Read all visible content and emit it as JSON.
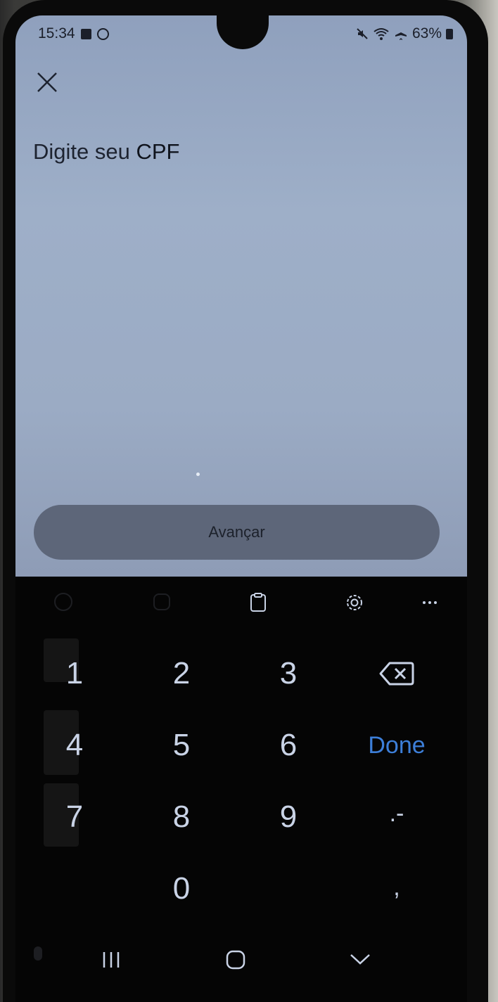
{
  "status_bar": {
    "time": "15:34",
    "battery": "63%"
  },
  "header": {
    "title_prefix": "Digite seu ",
    "title_bold": "CPF"
  },
  "actions": {
    "next_label": "Avançar"
  },
  "keyboard": {
    "keys": {
      "k1": "1",
      "k2": "2",
      "k3": "3",
      "k4": "4",
      "k5": "5",
      "k6": "6",
      "k7": "7",
      "k8": "8",
      "k9": "9",
      "k0": "0",
      "dotdash": ".-",
      "comma": ",",
      "done": "Done"
    }
  },
  "colors": {
    "screen_bg": "#9eafc8",
    "button_bg": "#5d6679",
    "done_accent": "#3d7fd9"
  }
}
